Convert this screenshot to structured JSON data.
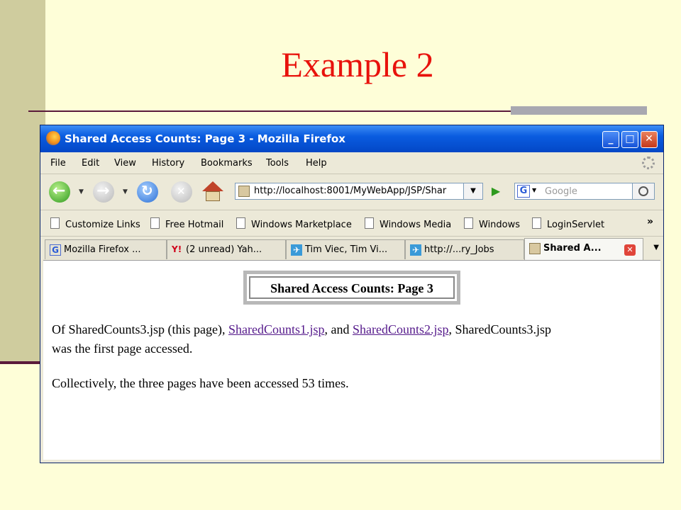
{
  "slide": {
    "title": "Example 2"
  },
  "window": {
    "title": "Shared Access Counts: Page 3 - Mozilla Firefox",
    "buttons": {
      "minimize": "_",
      "maximize": "□",
      "close": "✕"
    }
  },
  "menu": [
    "File",
    "Edit",
    "View",
    "History",
    "Bookmarks",
    "Tools",
    "Help"
  ],
  "menu_mnemonics": [
    "F",
    "E",
    "V",
    "s",
    "B",
    "T",
    "H"
  ],
  "nav": {
    "url": "http://localhost:8001/MyWebApp/JSP/Shar",
    "search_placeholder": "Google",
    "search_engine_icon": "G"
  },
  "bookmarks": [
    "Customize Links",
    "Free Hotmail",
    "Windows Marketplace",
    "Windows Media",
    "Windows",
    "LoginServlet"
  ],
  "bookmarks_overflow": "»",
  "tabs": [
    {
      "label": "Mozilla Firefox ...",
      "icon": "G"
    },
    {
      "label": "(2 unread) Yah...",
      "icon": "Y!"
    },
    {
      "label": "Tim Viec, Tim Vi...",
      "icon": "✈"
    },
    {
      "label": "http://...ry_Jobs",
      "icon": "✈"
    },
    {
      "label": "Shared A...",
      "icon": "",
      "active": true
    }
  ],
  "page": {
    "heading": "Shared Access Counts: Page 3",
    "para1_a": "Of SharedCounts3.jsp (this page), ",
    "link1": "SharedCounts1.jsp",
    "para1_b": ", and ",
    "link2": "SharedCounts2.jsp",
    "para1_c": ", SharedCounts3.jsp",
    "para1_d": "was the first page accessed.",
    "para2": "Collectively, the three pages have been accessed 53 times."
  },
  "colors": {
    "slide_bg": "#fefed8",
    "title_red": "#e8120c",
    "link_visited": "#551a8b"
  }
}
